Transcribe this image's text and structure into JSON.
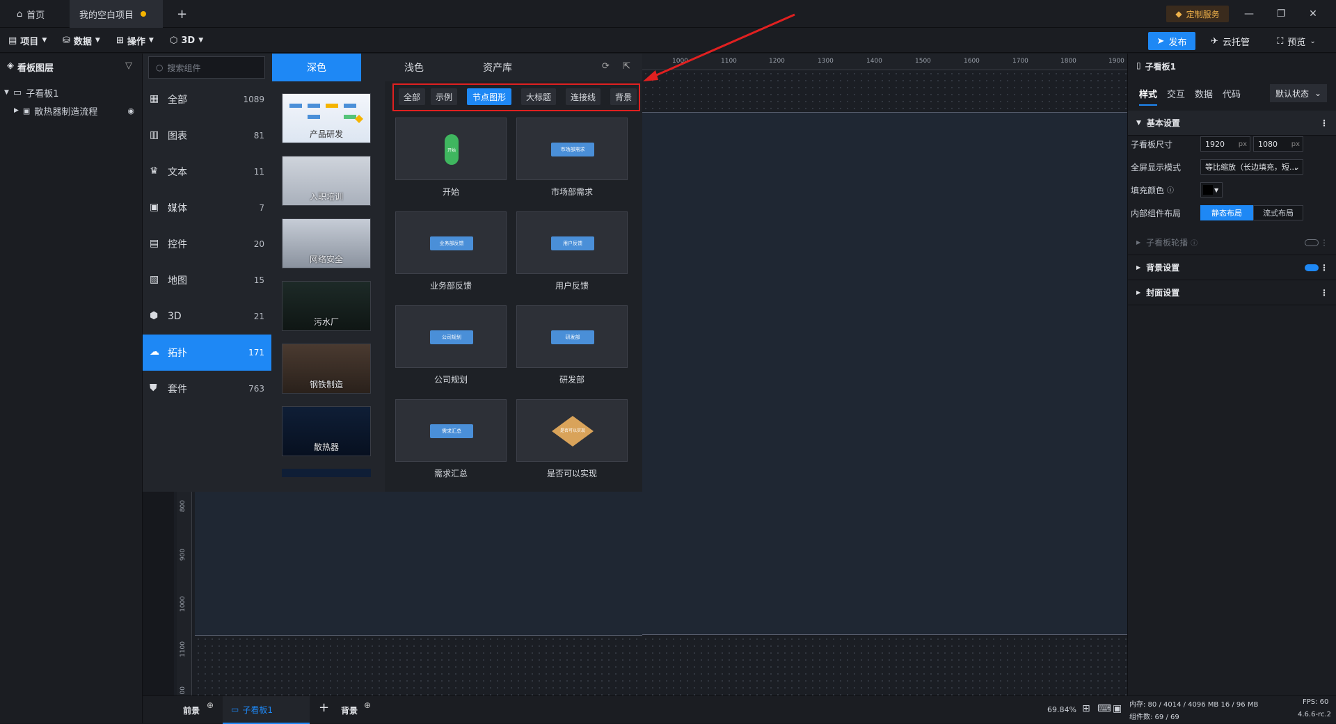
{
  "titlebar": {
    "home_tab": "首页",
    "project_tab": "我的空白项目",
    "new_tab": "+",
    "custom_service": "定制服务",
    "minimize": "—",
    "restore": "❐",
    "close": "✕"
  },
  "menubar": {
    "project": "项目",
    "data": "数据",
    "operate": "操作",
    "three_d": "3D",
    "publish": "发布",
    "cloud": "云托管",
    "preview": "预览"
  },
  "layers": {
    "title": "看板图层",
    "items": [
      {
        "label": "子看板1"
      },
      {
        "label": "散热器制造流程"
      }
    ]
  },
  "component_panel": {
    "search_placeholder": "搜索组件",
    "theme_tabs": [
      "深色",
      "浅色",
      "资产库"
    ],
    "categories": [
      {
        "label": "全部",
        "count": "1089",
        "icon": "grid-icon"
      },
      {
        "label": "图表",
        "count": "81",
        "icon": "bar-chart-icon"
      },
      {
        "label": "文本",
        "count": "11",
        "icon": "text-icon"
      },
      {
        "label": "媒体",
        "count": "7",
        "icon": "media-icon"
      },
      {
        "label": "控件",
        "count": "20",
        "icon": "control-icon"
      },
      {
        "label": "地图",
        "count": "15",
        "icon": "map-icon"
      },
      {
        "label": "3D",
        "count": "21",
        "icon": "cube-icon"
      },
      {
        "label": "拓扑",
        "count": "171",
        "icon": "topology-icon"
      },
      {
        "label": "套件",
        "count": "763",
        "icon": "kit-icon"
      }
    ],
    "templates": [
      "产品研发",
      "入职培训",
      "网络安全",
      "污水厂",
      "钢铁制造",
      "散热器"
    ],
    "filter_chips": [
      "全部",
      "示例",
      "节点图形",
      "大标题",
      "连接线",
      "背景"
    ],
    "cards": [
      {
        "label": "开始",
        "node_text": "开始"
      },
      {
        "label": "市场部需求",
        "node_text": "市场部需求"
      },
      {
        "label": "业务部反馈",
        "node_text": "业务部反馈"
      },
      {
        "label": "用户反馈",
        "node_text": "用户反馈"
      },
      {
        "label": "公司规划",
        "node_text": "公司规划"
      },
      {
        "label": "研发部",
        "node_text": "研发部"
      },
      {
        "label": "需求汇总",
        "node_text": "需求汇总"
      },
      {
        "label": "是否可以实现",
        "node_text": "是否可以实现"
      }
    ]
  },
  "rulers": {
    "top": [
      "1000",
      "1100",
      "1200",
      "1300",
      "1400",
      "1500",
      "1600",
      "1700",
      "1800",
      "1900"
    ],
    "left": [
      "800",
      "900",
      "1000",
      "1100",
      "00"
    ]
  },
  "props": {
    "title": "子看板1",
    "tabs": [
      "样式",
      "交互",
      "数据",
      "代码"
    ],
    "state": "默认状态",
    "basic": "基本设置",
    "size_label": "子看板尺寸",
    "width": "1920",
    "height": "1080",
    "unit": "px",
    "fullscreen_label": "全屏显示模式",
    "fullscreen_value": "等比缩放（长边填充，短...",
    "fill_label": "填充颜色",
    "fill_color": "#000000",
    "layout_label": "内部组件布局",
    "layout_static": "静态布局",
    "layout_flow": "流式布局",
    "carousel": "子看板轮播",
    "background": "背景设置",
    "cover": "封面设置"
  },
  "bottombar": {
    "front": "前景",
    "board": "子看板1",
    "add": "+",
    "back": "背景",
    "zoom": "69.84%",
    "memory": "内存: 80 / 4014 / 4096 MB  16 / 96 MB",
    "fps": "FPS: 60",
    "components": "组件数: 69 / 69",
    "version": "4.6.6-rc.2"
  }
}
